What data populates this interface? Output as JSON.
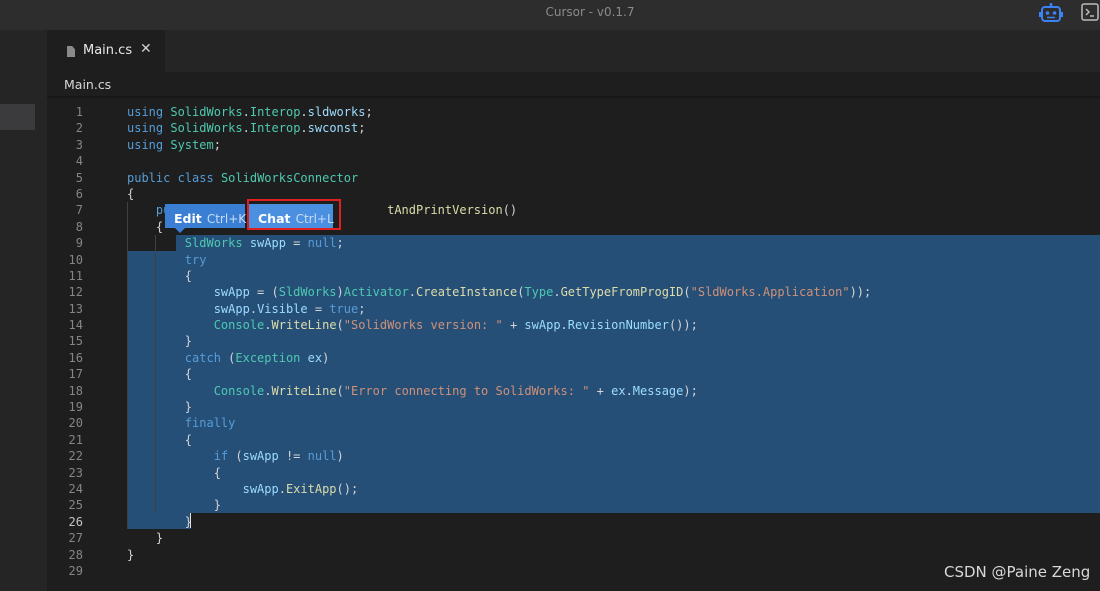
{
  "window": {
    "title": "Cursor - v0.1.7"
  },
  "titlebar_icons": {
    "assistant": "robot-icon",
    "terminal": "terminal-icon"
  },
  "tab": {
    "label": "Main.cs",
    "close_glyph": "✕",
    "icon": "file-icon"
  },
  "breadcrumb": "Main.cs",
  "popup": {
    "edit_label": "Edit",
    "edit_shortcut": "Ctrl+K",
    "chat_label": "Chat",
    "chat_shortcut": "Ctrl+L"
  },
  "editor": {
    "active_line": 26,
    "selection": "lines 9-26",
    "lines": [
      {
        "n": "1",
        "tokens": [
          [
            "kw",
            "using"
          ],
          [
            "",
            " "
          ],
          [
            "ty",
            "SolidWorks"
          ],
          [
            "",
            "."
          ],
          [
            "ty",
            "Interop"
          ],
          [
            "",
            "."
          ],
          [
            "id",
            "sldworks"
          ],
          [
            "",
            ";"
          ]
        ]
      },
      {
        "n": "2",
        "tokens": [
          [
            "kw",
            "using"
          ],
          [
            "",
            " "
          ],
          [
            "ty",
            "SolidWorks"
          ],
          [
            "",
            "."
          ],
          [
            "ty",
            "Interop"
          ],
          [
            "",
            "."
          ],
          [
            "id",
            "swconst"
          ],
          [
            "",
            ";"
          ]
        ]
      },
      {
        "n": "3",
        "tokens": [
          [
            "kw",
            "using"
          ],
          [
            "",
            " "
          ],
          [
            "ty",
            "System"
          ],
          [
            "",
            ";"
          ]
        ]
      },
      {
        "n": "4",
        "tokens": []
      },
      {
        "n": "5",
        "tokens": [
          [
            "kw",
            "public"
          ],
          [
            "",
            " "
          ],
          [
            "kw",
            "class"
          ],
          [
            "",
            " "
          ],
          [
            "ty",
            "SolidWorksConnector"
          ]
        ]
      },
      {
        "n": "6",
        "tokens": [
          [
            "",
            "{"
          ]
        ]
      },
      {
        "n": "7",
        "tokens": [
          [
            "",
            "    "
          ],
          [
            "kw",
            "pu"
          ],
          [
            "",
            "                              "
          ],
          [
            "fn",
            "tAndPrintVersion"
          ],
          [
            "",
            "()"
          ]
        ]
      },
      {
        "n": "8",
        "tokens": [
          [
            "",
            "    {"
          ]
        ]
      },
      {
        "n": "9",
        "tokens": [
          [
            "",
            "        "
          ],
          [
            "ty",
            "SldWorks"
          ],
          [
            "",
            " "
          ],
          [
            "id",
            "swApp"
          ],
          [
            "",
            " = "
          ],
          [
            "kw",
            "null"
          ],
          [
            "",
            ";"
          ]
        ]
      },
      {
        "n": "10",
        "tokens": [
          [
            "",
            "        "
          ],
          [
            "kw",
            "try"
          ]
        ]
      },
      {
        "n": "11",
        "tokens": [
          [
            "",
            "        {"
          ]
        ]
      },
      {
        "n": "12",
        "tokens": [
          [
            "",
            "            "
          ],
          [
            "id",
            "swApp"
          ],
          [
            "",
            " = ("
          ],
          [
            "ty",
            "SldWorks"
          ],
          [
            "",
            ")"
          ],
          [
            "ty",
            "Activator"
          ],
          [
            "",
            "."
          ],
          [
            "fn",
            "CreateInstance"
          ],
          [
            "",
            "("
          ],
          [
            "ty",
            "Type"
          ],
          [
            "",
            "."
          ],
          [
            "fn",
            "GetTypeFromProgID"
          ],
          [
            "",
            "("
          ],
          [
            "st",
            "\"SldWorks.Application\""
          ],
          [
            "",
            "));"
          ]
        ]
      },
      {
        "n": "13",
        "tokens": [
          [
            "",
            "            "
          ],
          [
            "id",
            "swApp"
          ],
          [
            "",
            "."
          ],
          [
            "id",
            "Visible"
          ],
          [
            "",
            " = "
          ],
          [
            "kw",
            "true"
          ],
          [
            "",
            ";"
          ]
        ]
      },
      {
        "n": "14",
        "tokens": [
          [
            "",
            "            "
          ],
          [
            "ty",
            "Console"
          ],
          [
            "",
            "."
          ],
          [
            "fn",
            "WriteLine"
          ],
          [
            "",
            "("
          ],
          [
            "st",
            "\"SolidWorks version: \""
          ],
          [
            "",
            " + "
          ],
          [
            "id",
            "swApp"
          ],
          [
            "",
            "."
          ],
          [
            "id",
            "RevisionNumber"
          ],
          [
            "",
            "());"
          ]
        ]
      },
      {
        "n": "15",
        "tokens": [
          [
            "",
            "        }"
          ]
        ]
      },
      {
        "n": "16",
        "tokens": [
          [
            "",
            "        "
          ],
          [
            "kw",
            "catch"
          ],
          [
            "",
            " ("
          ],
          [
            "ty",
            "Exception"
          ],
          [
            "",
            " "
          ],
          [
            "id",
            "ex"
          ],
          [
            "",
            ")"
          ]
        ]
      },
      {
        "n": "17",
        "tokens": [
          [
            "",
            "        {"
          ]
        ]
      },
      {
        "n": "18",
        "tokens": [
          [
            "",
            "            "
          ],
          [
            "ty",
            "Console"
          ],
          [
            "",
            "."
          ],
          [
            "fn",
            "WriteLine"
          ],
          [
            "",
            "("
          ],
          [
            "st",
            "\"Error connecting to SolidWorks: \""
          ],
          [
            "",
            " + "
          ],
          [
            "id",
            "ex"
          ],
          [
            "",
            "."
          ],
          [
            "id",
            "Message"
          ],
          [
            "",
            ");"
          ]
        ]
      },
      {
        "n": "19",
        "tokens": [
          [
            "",
            "        }"
          ]
        ]
      },
      {
        "n": "20",
        "tokens": [
          [
            "",
            "        "
          ],
          [
            "kw",
            "finally"
          ]
        ]
      },
      {
        "n": "21",
        "tokens": [
          [
            "",
            "        {"
          ]
        ]
      },
      {
        "n": "22",
        "tokens": [
          [
            "",
            "            "
          ],
          [
            "kw",
            "if"
          ],
          [
            "",
            " ("
          ],
          [
            "id",
            "swApp"
          ],
          [
            "",
            " != "
          ],
          [
            "kw",
            "null"
          ],
          [
            "",
            ")"
          ]
        ]
      },
      {
        "n": "23",
        "tokens": [
          [
            "",
            "            {"
          ]
        ]
      },
      {
        "n": "24",
        "tokens": [
          [
            "",
            "                "
          ],
          [
            "id",
            "swApp"
          ],
          [
            "",
            "."
          ],
          [
            "fn",
            "ExitApp"
          ],
          [
            "",
            "();"
          ]
        ]
      },
      {
        "n": "25",
        "tokens": [
          [
            "",
            "            }"
          ]
        ]
      },
      {
        "n": "26",
        "tokens": [
          [
            "",
            "        }"
          ]
        ]
      },
      {
        "n": "27",
        "tokens": [
          [
            "",
            "    }"
          ]
        ]
      },
      {
        "n": "28",
        "tokens": [
          [
            "",
            "}"
          ]
        ]
      },
      {
        "n": "29",
        "tokens": []
      }
    ]
  },
  "watermark": "CSDN @Paine Zeng",
  "colors": {
    "background": "#1e1e1e",
    "selection": "#264f78",
    "popup": "#3a7fd4",
    "highlight_box": "#e02020",
    "keyword": "#569cd6",
    "type": "#4ec9b0",
    "method": "#dcdcaa",
    "string": "#ce9178",
    "identifier": "#9cdcfe"
  }
}
